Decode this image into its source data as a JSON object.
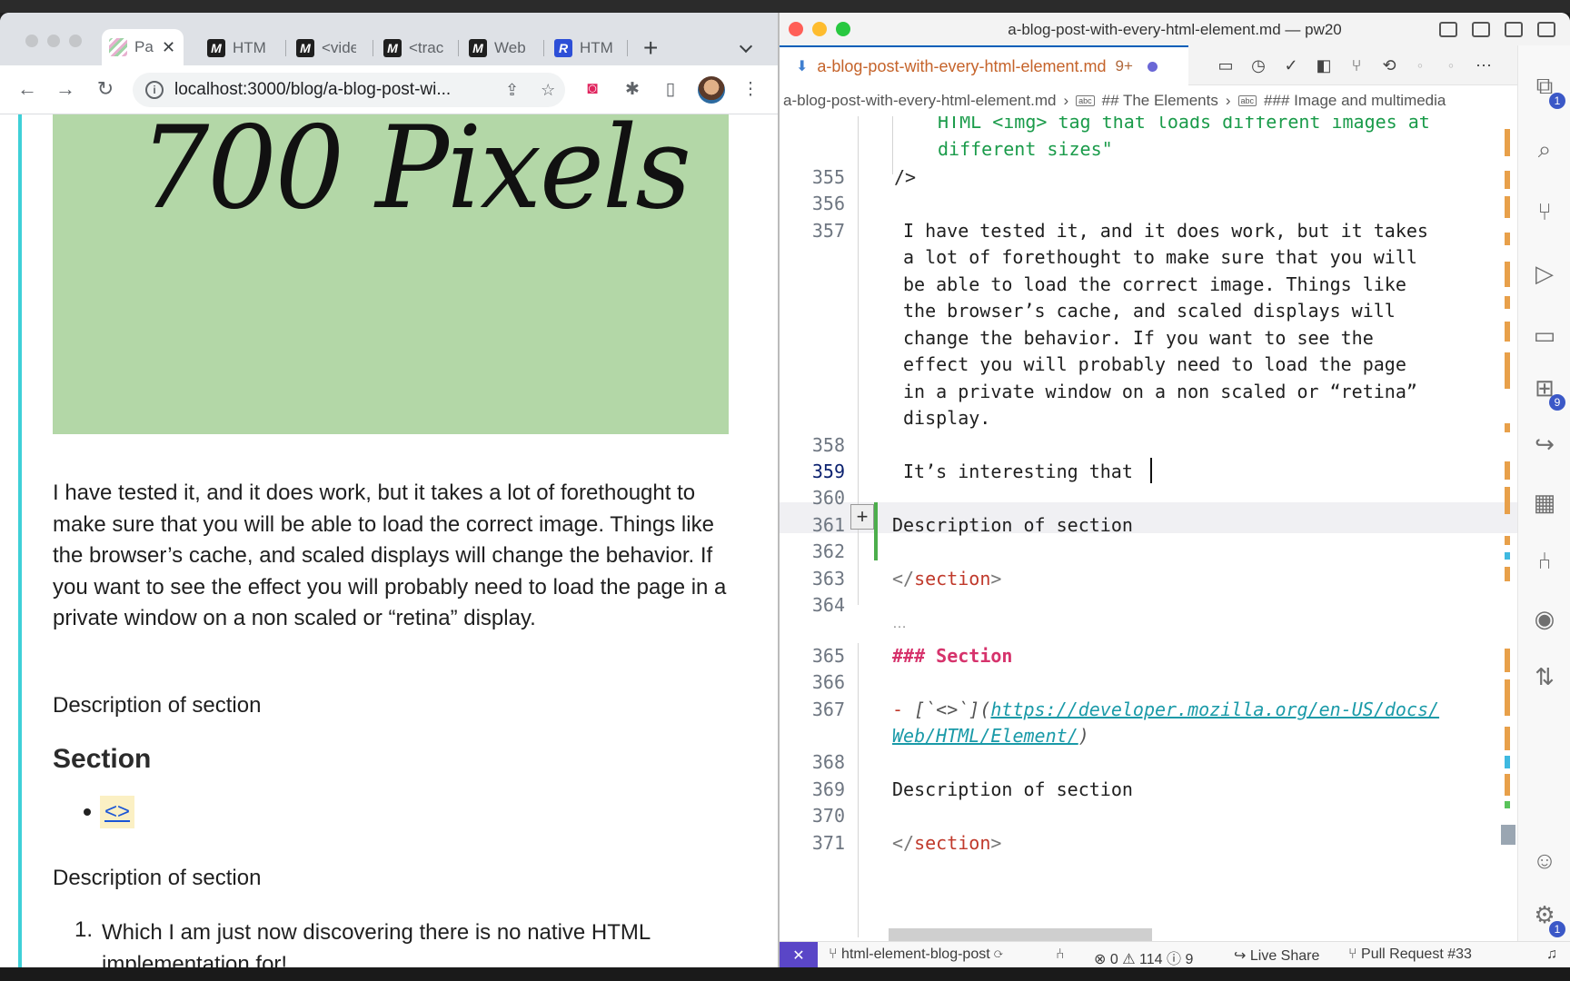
{
  "browser": {
    "tabs": [
      {
        "label": "Pa",
        "favicon": "stripes",
        "active": true
      },
      {
        "label": "HTML",
        "favicon": "M"
      },
      {
        "label": "<vide",
        "favicon": "M"
      },
      {
        "label": "<trac",
        "favicon": "M"
      },
      {
        "label": "Web",
        "favicon": "M"
      },
      {
        "label": "HTML",
        "favicon": "R"
      }
    ],
    "url": "localhost:3000/blog/a-blog-post-wi...",
    "page": {
      "hero_text": "700 Pixels",
      "hero_color": "#b3d7a7",
      "paragraph": "I have tested it, and it does work, but it takes a lot of forethought to make sure that you will be able to load the correct image. Things like the browser’s cache, and scaled displays will change the behavior. If you want to see the effect you will probably need to load the page in a private window on a non scaled or “retina” display.",
      "desc1": "Description of section",
      "section_heading": "Section",
      "link_text": "<>",
      "desc2": "Description of section",
      "ol_number": "1.",
      "ol_item": "Which I am just now discovering there is no native HTML implementation for!"
    }
  },
  "vscode": {
    "window_title": "a-blog-post-with-every-html-element.md — pw20",
    "tab": {
      "label": "a-blog-post-with-every-html-element.md",
      "problems": "9+"
    },
    "breadcrumbs": [
      "a-blog-post-with-every-html-element.md",
      "## The Elements",
      "### Image and multimedia"
    ],
    "lines": {
      "l354a": "HTML <img> tag that loads different images at",
      "l354b": "different sizes\"",
      "l355": "/>",
      "l357a": "I have tested it, and it does work, but it takes",
      "l357b": "a lot of forethought to make sure that you will",
      "l357c": "be able to load the correct image. Things like",
      "l357d": "the browser’s cache, and scaled displays will",
      "l357e": "change the behavior. If you want to see the",
      "l357f": "effect you will probably need to load the page",
      "l357g": "in a private window on a non scaled or “retina”",
      "l357h": "display.",
      "l359": "It’s interesting that",
      "l361": "Description of section",
      "l363_open": "</",
      "l363_tag": "section",
      "l363_close": ">",
      "l365_hash": "###",
      "l365_title": "Section",
      "l367_dash": "-",
      "l367_md": "[`<>`](",
      "l367_url1": "https://developer.mozilla.org/en-US/docs/",
      "l367_url2": "Web/HTML/Element/",
      "l367_end": ")",
      "l369": "Description of section",
      "l371_open": "</",
      "l371_tag": "section",
      "l371_close": ">"
    },
    "line_numbers": [
      "355",
      "356",
      "357",
      "358",
      "359",
      "360",
      "361",
      "362",
      "363",
      "364",
      "365",
      "366",
      "367",
      "368",
      "369",
      "370",
      "371"
    ],
    "ellipsis": "…",
    "activity_badges": {
      "explorer": "1",
      "extensions": "9",
      "settings": "1"
    },
    "status": {
      "branch": "html-element-blog-post",
      "errors": "0",
      "warnings": "114",
      "infos": "9",
      "live_share": "Live Share",
      "pull_request": "Pull Request #33"
    },
    "colors": {
      "accent": "#5a46c7",
      "git_added": "#4cae4c",
      "string": "#1a9b4a",
      "tag": "#c0392b",
      "heading": "#d6336c",
      "link": "#1a9aa8"
    }
  }
}
